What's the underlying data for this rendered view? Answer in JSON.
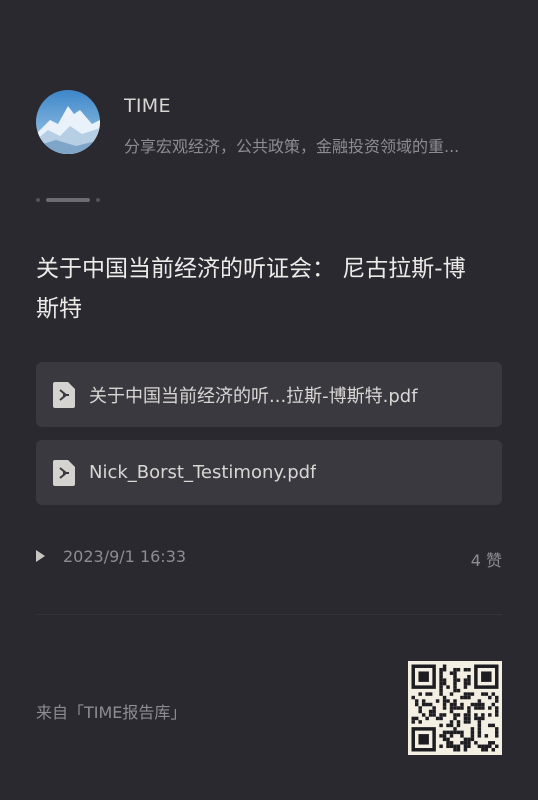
{
  "account": {
    "name": "TIME",
    "description": "分享宏观经济，公共政策，金融投资领域的重..."
  },
  "post": {
    "title": "关于中国当前经济的听证会： 尼古拉斯-博斯特",
    "attachments": [
      {
        "name": "关于中国当前经济的听...拉斯-博斯特.pdf",
        "icon": "pdf-file-icon"
      },
      {
        "name": "Nick_Borst_Testimony.pdf",
        "icon": "pdf-file-icon"
      }
    ],
    "timestamp": "2023/9/1 16:33",
    "likes": "4 赞"
  },
  "footer": {
    "source": "来自「TIME报告库」",
    "qr_icon": "qr-code-icon"
  },
  "colors": {
    "background": "#2a2930",
    "card": "#3a3940",
    "muted_text": "#8e8c93"
  }
}
